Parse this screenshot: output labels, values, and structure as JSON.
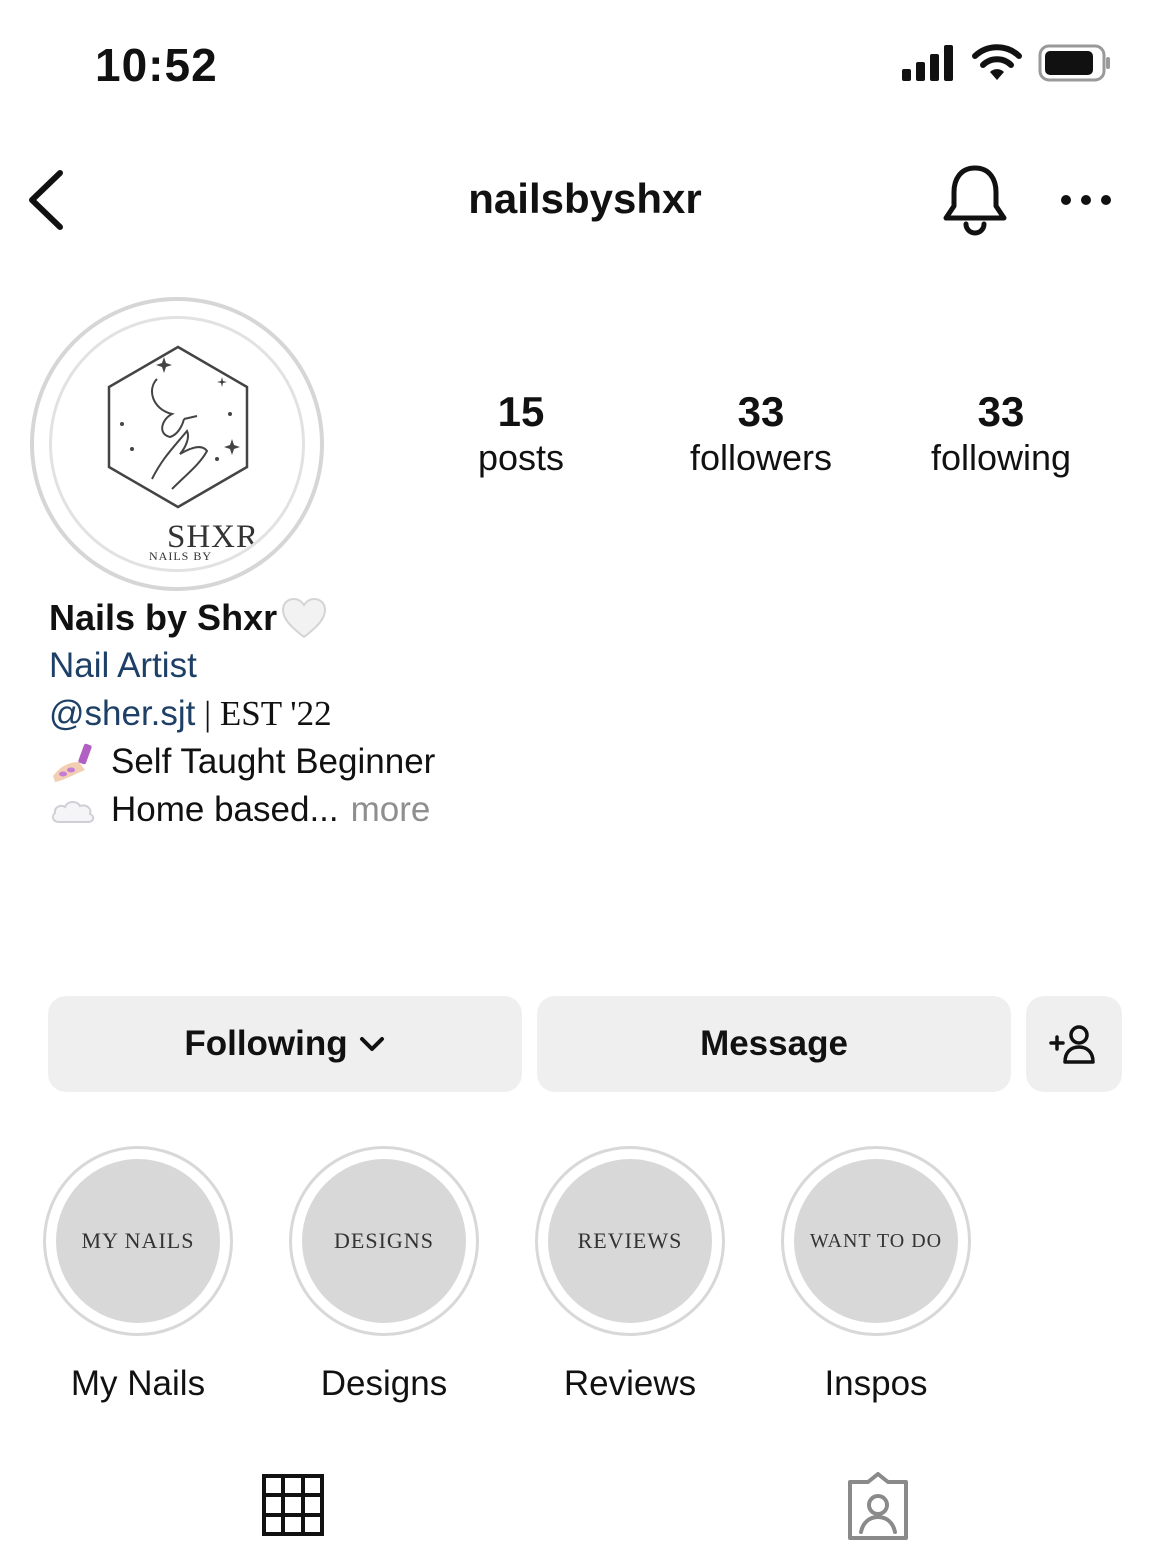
{
  "status_bar": {
    "time": "10:52",
    "icons": [
      "signal-icon",
      "wifi-icon",
      "battery-icon"
    ]
  },
  "header": {
    "title": "nailsbyshxr",
    "icons": [
      "back-chevron-icon",
      "bell-icon",
      "more-icon"
    ]
  },
  "avatar": {
    "logo_main": "SHXR",
    "logo_sub": "NAILS BY"
  },
  "stats": [
    {
      "value": "15",
      "label": "posts"
    },
    {
      "value": "33",
      "label": "followers"
    },
    {
      "value": "33",
      "label": "following"
    }
  ],
  "bio": {
    "name": "Nails by Shxr",
    "category": "Nail Artist",
    "handle": "@sher.sjt",
    "est": " | EST '22",
    "line1": "Self Taught Beginner",
    "line2": "Home based...",
    "more": "more"
  },
  "buttons": {
    "following": "Following",
    "message": "Message"
  },
  "highlights": [
    {
      "cover": "MY NAILS",
      "label": "My Nails"
    },
    {
      "cover": "DESIGNS",
      "label": "Designs"
    },
    {
      "cover": "REVIEWS",
      "label": "Reviews"
    },
    {
      "cover": "WANT TO DO",
      "label": "Inspos"
    }
  ],
  "colors": {
    "link": "#1e3f66",
    "button_bg": "#efefef",
    "highlight_bg": "#d8d8d8",
    "muted": "#8e8e8e"
  }
}
